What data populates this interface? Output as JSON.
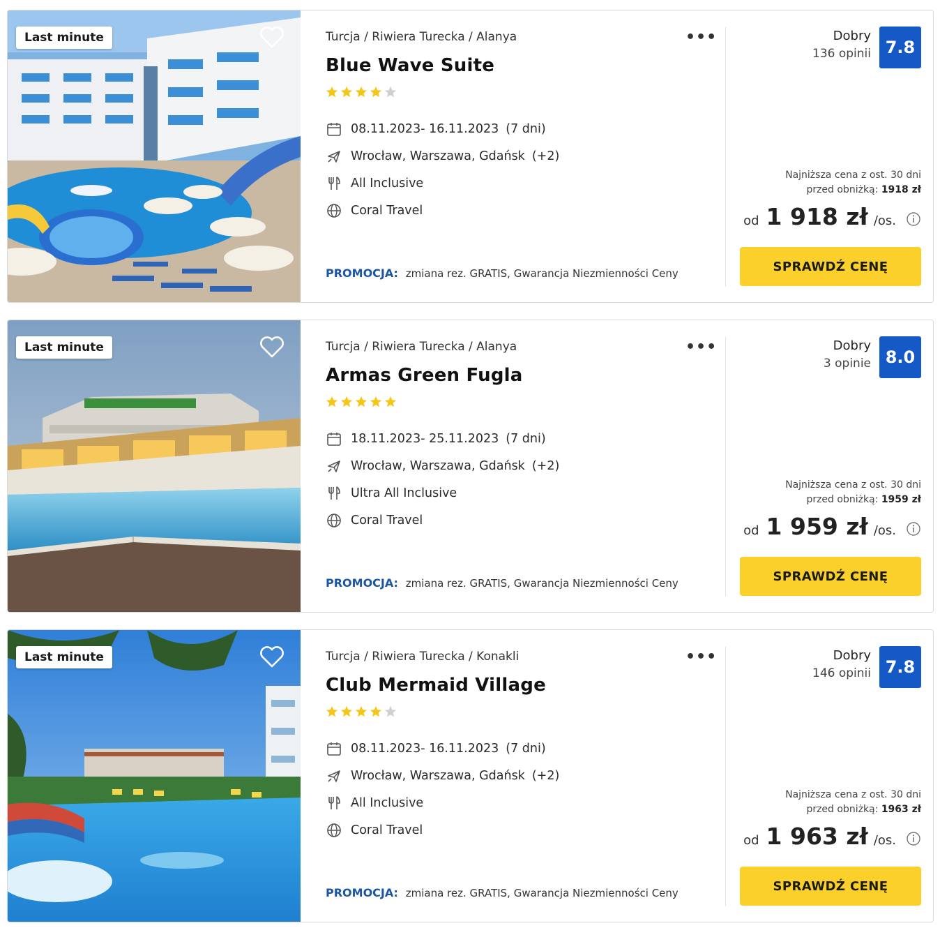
{
  "offers": [
    {
      "badge": "Last minute",
      "location": "Turcja / Riwiera Turecka / Alanya",
      "name": "Blue Wave Suite",
      "stars_filled": 4,
      "stars_total": 5,
      "dates": "08.11.2023- 16.11.2023",
      "duration": "(7 dni)",
      "departure": "Wrocław, Warszawa, Gdańsk",
      "departure_extra": "(+2)",
      "board": "All Inclusive",
      "operator": "Coral Travel",
      "promo_label": "PROMOCJA:",
      "promo_text": "zmiana rez. GRATIS, Gwarancja Niezmienności Ceny",
      "rating_label": "Dobry",
      "opinions": "136 opinii",
      "score": "7.8",
      "lowest_line1": "Najniższa cena z ost. 30 dni",
      "lowest_line2": "przed obniżką:",
      "lowest_value": "1918 zł",
      "price_prefix": "od",
      "price": "1 918 zł",
      "price_suffix": "/os.",
      "button": "SPRAWDŹ CENĘ",
      "photo": "pool-hotel"
    },
    {
      "badge": "Last minute",
      "location": "Turcja / Riwiera Turecka / Alanya",
      "name": "Armas Green Fugla",
      "stars_filled": 5,
      "stars_total": 5,
      "dates": "18.11.2023- 25.11.2023",
      "duration": "(7 dni)",
      "departure": "Wrocław, Warszawa, Gdańsk",
      "departure_extra": "(+2)",
      "board": "Ultra All Inclusive",
      "operator": "Coral Travel",
      "promo_label": "PROMOCJA:",
      "promo_text": "zmiana rez. GRATIS, Gwarancja Niezmienności Ceny",
      "rating_label": "Dobry",
      "opinions": "3 opinie",
      "score": "8.0",
      "lowest_line1": "Najniższa cena z ost. 30 dni",
      "lowest_line2": "przed obniżką:",
      "lowest_value": "1959 zł",
      "price_prefix": "od",
      "price": "1 959 zł",
      "price_suffix": "/os.",
      "button": "SPRAWDŹ CENĘ",
      "photo": "evening-pool"
    },
    {
      "badge": "Last minute",
      "location": "Turcja / Riwiera Turecka / Konakli",
      "name": "Club Mermaid Village",
      "stars_filled": 4,
      "stars_total": 5,
      "dates": "08.11.2023- 16.11.2023",
      "duration": "(7 dni)",
      "departure": "Wrocław, Warszawa, Gdańsk",
      "departure_extra": "(+2)",
      "board": "All Inclusive",
      "operator": "Coral Travel",
      "promo_label": "PROMOCJA:",
      "promo_text": "zmiana rez. GRATIS, Gwarancja Niezmienności Ceny",
      "rating_label": "Dobry",
      "opinions": "146 opinii",
      "score": "7.8",
      "lowest_line1": "Najniższa cena z ost. 30 dni",
      "lowest_line2": "przed obniżką:",
      "lowest_value": "1963 zł",
      "price_prefix": "od",
      "price": "1 963 zł",
      "price_suffix": "/os.",
      "button": "SPRAWDŹ CENĘ",
      "photo": "waterpark-pool"
    }
  ],
  "colors": {
    "accent_blue": "#1559c7",
    "promo_blue": "#1a56a4",
    "button_yellow": "#fcd02a",
    "star_yellow": "#f5c518",
    "star_grey": "#cfcfcf"
  }
}
